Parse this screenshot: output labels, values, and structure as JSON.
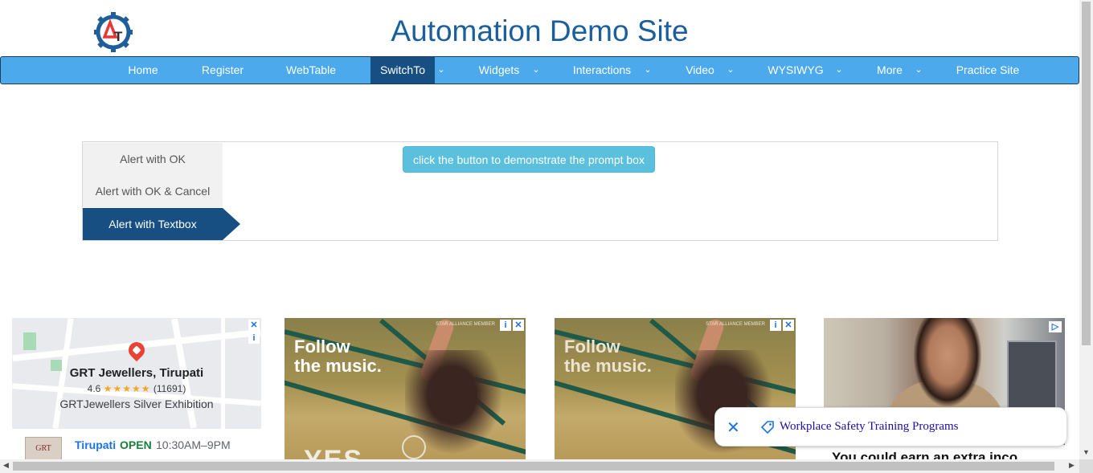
{
  "header": {
    "logo_icon": "gear-logo-icon",
    "title": "Automation Demo Site"
  },
  "nav": {
    "items": [
      {
        "label": "Home"
      },
      {
        "label": "Register"
      },
      {
        "label": "WebTable"
      },
      {
        "label": "SwitchTo",
        "active": true
      },
      {
        "label": "Widgets"
      },
      {
        "label": "Interactions"
      },
      {
        "label": "Video"
      },
      {
        "label": "WYSIWYG"
      },
      {
        "label": "More"
      },
      {
        "label": "Practice Site"
      }
    ],
    "caret": "⌄"
  },
  "alerts": {
    "tabs": [
      {
        "label": "Alert with OK"
      },
      {
        "label": "Alert with OK & Cancel"
      },
      {
        "label": "Alert with Textbox",
        "active": true
      }
    ],
    "button_label": "click the button to demonstrate the prompt box"
  },
  "ads": {
    "map": {
      "title": "GRT Jewellers, Tirupati",
      "rating": "4.6",
      "stars": "★★★★★",
      "reviews": "(11691)",
      "subtitle": "GRTJewellers Silver Exhibition",
      "thumb_text": "GRT",
      "city": "Tirupati",
      "status": "OPEN",
      "hours": "10:30AM–9PM"
    },
    "music": {
      "line1": "Follow",
      "line2": "the music.",
      "partner": "STAR ALLIANCE MEMBER",
      "bottom": "YES"
    },
    "music2": {
      "line1": "Follow",
      "line2": "the music.",
      "partner": "STAR ALLIANCE MEMBER"
    },
    "woman": {
      "headline": "You could earn an extra inco"
    },
    "floating": {
      "label": "Workplace Safety Training Programs",
      "close": "✕"
    }
  },
  "colors": {
    "brand_title": "#1a5f9c",
    "nav_bg": "#4ba9ec",
    "nav_active": "#174f82",
    "button": "#5bc0de"
  }
}
